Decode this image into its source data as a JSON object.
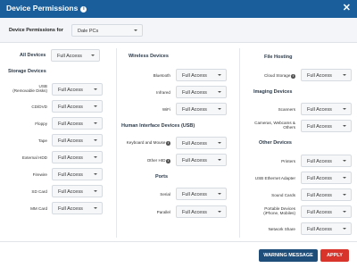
{
  "dialog": {
    "title": "Device Permissions",
    "close_glyph": "✕"
  },
  "group_select": {
    "label": "Device Permissions for",
    "value": "Dale PCs"
  },
  "column1": {
    "all_devices": {
      "label": "All Devices",
      "value": "Full Access"
    },
    "section": "Storage Devices",
    "rows": [
      {
        "label_line1": "USB",
        "label_line2": "(Removable Disks)",
        "value": "Full Access"
      },
      {
        "label_line1": "CD/DVD",
        "value": "Full Access"
      },
      {
        "label_line1": "Floppy",
        "value": "Full Access"
      },
      {
        "label_line1": "Tape",
        "value": "Full Access"
      },
      {
        "label_line1": "External HDD",
        "value": "Full Access"
      },
      {
        "label_line1": "Firewire",
        "value": "Full Access"
      },
      {
        "label_line1": "SD Card",
        "value": "Full Access"
      },
      {
        "label_line1": "MM Card",
        "value": "Full Access"
      }
    ]
  },
  "column2": {
    "wireless": {
      "section": "Wireless Devices",
      "rows": [
        {
          "label": "Bluetooth",
          "value": "Full Access"
        },
        {
          "label": "Infrared",
          "value": "Full Access"
        },
        {
          "label": "WiFi",
          "value": "Full Access"
        }
      ]
    },
    "hid": {
      "section": "Human Interface Devices (USB)",
      "rows": [
        {
          "label": "Keyboard and Mouse",
          "value": "Full Access",
          "info": true
        },
        {
          "label": "Other HID",
          "value": "Full Access",
          "info": true
        }
      ]
    },
    "ports": {
      "section": "Ports",
      "rows": [
        {
          "label": "Serial",
          "value": "Full Access"
        },
        {
          "label": "Parallel",
          "value": "Full Access"
        }
      ]
    }
  },
  "column3": {
    "file_hosting": {
      "section": "File Hosting",
      "rows": [
        {
          "label": "Cloud Storage",
          "value": "Full Access",
          "info": true
        }
      ]
    },
    "imaging": {
      "section": "Imaging Devices",
      "rows": [
        {
          "label_line1": "Scanners",
          "value": "Full Access"
        },
        {
          "label_line1": "Cameras, Webcams &",
          "label_line2": "Others",
          "value": "Full Access"
        }
      ]
    },
    "other": {
      "section": "Other Devices",
      "rows": [
        {
          "label_line1": "Printers",
          "value": "Full Access"
        },
        {
          "label_line1": "USB Ethernet Adapter",
          "value": "Full Access"
        },
        {
          "label_line1": "Sound Cards",
          "value": "Full Access"
        },
        {
          "label_line1": "Portable Devices",
          "label_line2": "(iPhone, Mobiles)",
          "value": "Full Access"
        },
        {
          "label_line1": "Network Share",
          "value": "Full Access"
        }
      ]
    }
  },
  "footer": {
    "warning_label": "WARNING MESSAGE",
    "apply_label": "APPLY"
  },
  "colors": {
    "header_bg": "#1a5f9c",
    "apply_bg": "#d9342b",
    "warning_bg": "#1f4e7a"
  },
  "icons": {
    "info": "info-icon",
    "close": "close-icon",
    "dropdown": "chevron-down-icon"
  }
}
